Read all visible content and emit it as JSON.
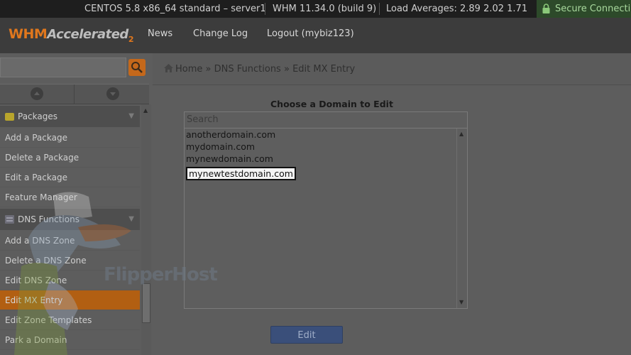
{
  "status_bar": {
    "os": "CENTOS 5.8 x86_64 standard – server1",
    "version": "WHM 11.34.0 (build 9)",
    "load": "Load Averages: 2.89 2.02 1.71",
    "secure": "Secure Connection"
  },
  "brand": {
    "whm": "WHM",
    "accelerated": "Accelerated",
    "superscript": "2"
  },
  "nav": {
    "news": "News",
    "changelog": "Change Log",
    "logout": "Logout (mybiz123)"
  },
  "sidebar": {
    "groups": [
      {
        "label": "Packages",
        "items": [
          "Add a Package",
          "Delete a Package",
          "Edit a Package",
          "Feature Manager"
        ]
      },
      {
        "label": "DNS Functions",
        "items": [
          "Add a DNS Zone",
          "Delete a DNS Zone",
          "Edit DNS Zone",
          "Edit MX Entry",
          "Edit Zone Templates",
          "Park a Domain"
        ]
      }
    ],
    "active_item": "Edit MX Entry"
  },
  "breadcrumb": [
    "Home",
    "DNS Functions",
    "Edit MX Entry"
  ],
  "breadcrumb_sep": "»",
  "panel": {
    "title": "Choose a Domain to Edit",
    "search_placeholder": "Search",
    "domains": [
      "anotherdomain.com",
      "mydomain.com",
      "mynewdomain.com",
      "mynewtestdomain.com"
    ],
    "selected_domain": "mynewtestdomain.com",
    "edit_label": "Edit"
  },
  "watermark": {
    "text": "FlipperHost"
  },
  "colors": {
    "accent_orange": "#e0771d",
    "active_item": "#b25f12",
    "edit_button": "#3a4f7a",
    "secure_green": "#2d4a2a"
  }
}
